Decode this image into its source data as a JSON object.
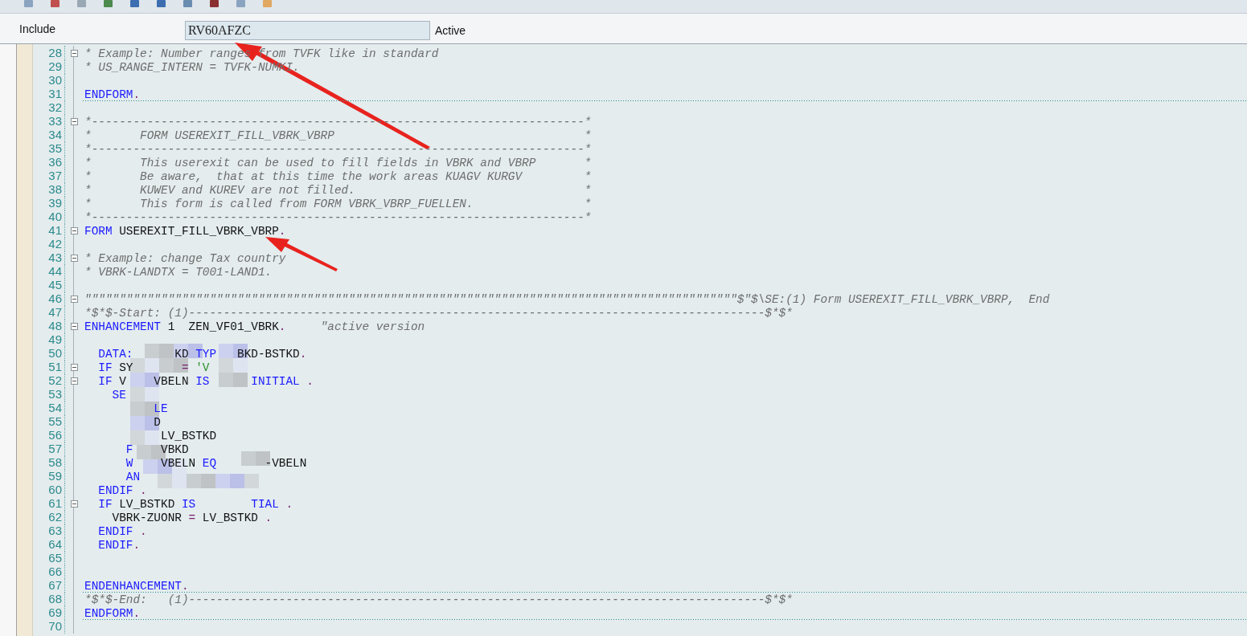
{
  "header": {
    "label": "Include",
    "value": "RV60AFZC",
    "status": "Active"
  },
  "editor": {
    "lines": [
      {
        "number": "28",
        "fold_start": true,
        "separator": false,
        "tokens": [
          {
            "kind": "comment",
            "text": "* Example: Number ranges from TVFK like in standard"
          }
        ]
      },
      {
        "number": "29",
        "fold_start": false,
        "separator": false,
        "tokens": [
          {
            "kind": "comment",
            "text": "* US_RANGE_INTERN = TVFK-NUMKI."
          }
        ]
      },
      {
        "number": "30",
        "fold_start": false,
        "separator": false
      },
      {
        "number": "31",
        "fold_start": false,
        "separator": true,
        "tokens": [
          {
            "kind": "keyword",
            "text": "ENDFORM"
          },
          {
            "kind": "punct",
            "text": "."
          }
        ]
      },
      {
        "number": "32",
        "fold_start": false,
        "separator": false
      },
      {
        "number": "33",
        "fold_start": true,
        "separator": false,
        "tokens": [
          {
            "kind": "comment",
            "text": "*-----------------------------------------------------------------------*"
          }
        ]
      },
      {
        "number": "34",
        "fold_start": false,
        "separator": false,
        "tokens": [
          {
            "kind": "comment",
            "text": "*       FORM USEREXIT_FILL_VBRK_VBRP                                    *"
          }
        ]
      },
      {
        "number": "35",
        "fold_start": false,
        "separator": false,
        "tokens": [
          {
            "kind": "comment",
            "text": "*-----------------------------------------------------------------------*"
          }
        ]
      },
      {
        "number": "36",
        "fold_start": false,
        "separator": false,
        "tokens": [
          {
            "kind": "comment",
            "text": "*       This userexit can be used to fill fields in VBRK and VBRP       *"
          }
        ]
      },
      {
        "number": "37",
        "fold_start": false,
        "separator": false,
        "tokens": [
          {
            "kind": "comment",
            "text": "*       Be aware,  that at this time the work areas KUAGV KURGV         *"
          }
        ]
      },
      {
        "number": "38",
        "fold_start": false,
        "separator": false,
        "tokens": [
          {
            "kind": "comment",
            "text": "*       KUWEV and KUREV are not filled.                                 *"
          }
        ]
      },
      {
        "number": "39",
        "fold_start": false,
        "separator": false,
        "tokens": [
          {
            "kind": "comment",
            "text": "*       This form is called from FORM VBRK_VBRP_FUELLEN.                *"
          }
        ]
      },
      {
        "number": "40",
        "fold_start": false,
        "separator": false,
        "tokens": [
          {
            "kind": "comment",
            "text": "*-----------------------------------------------------------------------*"
          }
        ]
      },
      {
        "number": "41",
        "fold_start": true,
        "separator": false,
        "tokens": [
          {
            "kind": "keyword",
            "text": "FORM"
          },
          {
            "kind": "plain",
            "text": " USEREXIT_FILL_VBRK_VBRP"
          },
          {
            "kind": "punct",
            "text": "."
          }
        ]
      },
      {
        "number": "42",
        "fold_start": false,
        "separator": false
      },
      {
        "number": "43",
        "fold_start": true,
        "separator": false,
        "tokens": [
          {
            "kind": "comment",
            "text": "* Example: change Tax country"
          }
        ]
      },
      {
        "number": "44",
        "fold_start": false,
        "separator": false,
        "tokens": [
          {
            "kind": "comment",
            "text": "* VBRK-LANDTX = T001-LAND1."
          }
        ]
      },
      {
        "number": "45",
        "fold_start": false,
        "separator": false
      },
      {
        "number": "46",
        "fold_start": true,
        "separator": false,
        "tokens": [
          {
            "kind": "comment",
            "text": "\"\"\"\"\"\"\"\"\"\"\"\"\"\"\"\"\"\"\"\"\"\"\"\"\"\"\"\"\"\"\"\"\"\"\"\"\"\"\"\"\"\"\"\"\"\"\"\"\"\"\"\"\"\"\"\"\"\"\"\"\"\"\"\"\"\"\"\"\"\"\"\"\"\"\"\"\"\"\"\"\"\"\"\"\"\"\"\"\"\"\"\"\"\"$\"$\\SE:(1) Form USEREXIT_FILL_VBRK_VBRP,  End"
          }
        ]
      },
      {
        "number": "47",
        "fold_start": false,
        "separator": false,
        "tokens": [
          {
            "kind": "comment",
            "text": "*$*$-Start: (1)-----------------------------------------------------------------------------------$*$*"
          }
        ]
      },
      {
        "number": "48",
        "fold_start": true,
        "separator": false,
        "tokens": [
          {
            "kind": "keyword",
            "text": "ENHANCEMENT"
          },
          {
            "kind": "plain",
            "text": " 1  ZEN_VF01_VBRK"
          },
          {
            "kind": "punct",
            "text": "."
          },
          {
            "kind": "comment",
            "text": "     \"active version"
          }
        ]
      },
      {
        "number": "49",
        "fold_start": false,
        "separator": false
      },
      {
        "number": "50",
        "fold_start": false,
        "separator": false,
        "tokens": [
          {
            "kind": "keyword",
            "text": "  DATA:"
          },
          {
            "kind": "plain",
            "text": "      KD "
          },
          {
            "kind": "keyword",
            "text": "TYP"
          },
          {
            "kind": "plain",
            "text": "   BKD-BSTKD"
          },
          {
            "kind": "punct",
            "text": "."
          }
        ]
      },
      {
        "number": "51",
        "fold_start": true,
        "separator": false,
        "tokens": [
          {
            "kind": "keyword",
            "text": "  IF"
          },
          {
            "kind": "plain",
            "text": " SY       "
          },
          {
            "kind": "punct",
            "text": "="
          },
          {
            "kind": "string",
            "text": " 'V"
          }
        ]
      },
      {
        "number": "52",
        "fold_start": true,
        "separator": false,
        "tokens": [
          {
            "kind": "keyword",
            "text": "  IF"
          },
          {
            "kind": "plain",
            "text": " V    VBELN "
          },
          {
            "kind": "keyword",
            "text": "IS"
          },
          {
            "kind": "keyword",
            "text": "      INITIAL"
          },
          {
            "kind": "punct",
            "text": " ."
          }
        ]
      },
      {
        "number": "53",
        "fold_start": false,
        "separator": false,
        "tokens": [
          {
            "kind": "keyword",
            "text": "    SE"
          }
        ]
      },
      {
        "number": "54",
        "fold_start": false,
        "separator": false,
        "tokens": [
          {
            "kind": "keyword",
            "text": "          LE"
          }
        ]
      },
      {
        "number": "55",
        "fold_start": false,
        "separator": false,
        "tokens": [
          {
            "kind": "plain",
            "text": "          D"
          }
        ]
      },
      {
        "number": "56",
        "fold_start": false,
        "separator": false,
        "tokens": [
          {
            "kind": "plain",
            "text": "           LV_BSTKD"
          }
        ]
      },
      {
        "number": "57",
        "fold_start": false,
        "separator": false,
        "tokens": [
          {
            "kind": "keyword",
            "text": "      F"
          },
          {
            "kind": "plain",
            "text": "    VBKD"
          }
        ]
      },
      {
        "number": "58",
        "fold_start": false,
        "separator": false,
        "tokens": [
          {
            "kind": "keyword",
            "text": "      W"
          },
          {
            "kind": "plain",
            "text": "    VBELN "
          },
          {
            "kind": "keyword",
            "text": "EQ"
          },
          {
            "kind": "plain",
            "text": "       -VBELN"
          }
        ]
      },
      {
        "number": "59",
        "fold_start": false,
        "separator": false,
        "tokens": [
          {
            "kind": "keyword",
            "text": "      AN"
          }
        ]
      },
      {
        "number": "60",
        "fold_start": false,
        "separator": false,
        "tokens": [
          {
            "kind": "keyword",
            "text": "  ENDIF"
          },
          {
            "kind": "punct",
            "text": " ."
          }
        ]
      },
      {
        "number": "61",
        "fold_start": true,
        "separator": false,
        "tokens": [
          {
            "kind": "keyword",
            "text": "  IF"
          },
          {
            "kind": "plain",
            "text": " LV_BSTKD "
          },
          {
            "kind": "keyword",
            "text": "IS"
          },
          {
            "kind": "keyword",
            "text": "        TIAL"
          },
          {
            "kind": "punct",
            "text": " ."
          }
        ]
      },
      {
        "number": "62",
        "fold_start": false,
        "separator": false,
        "tokens": [
          {
            "kind": "plain",
            "text": "    VBRK-ZUONR "
          },
          {
            "kind": "punct",
            "text": "="
          },
          {
            "kind": "plain",
            "text": " LV_BSTKD "
          },
          {
            "kind": "punct",
            "text": "."
          }
        ]
      },
      {
        "number": "63",
        "fold_start": false,
        "separator": false,
        "tokens": [
          {
            "kind": "keyword",
            "text": "  ENDIF"
          },
          {
            "kind": "punct",
            "text": " ."
          }
        ]
      },
      {
        "number": "64",
        "fold_start": false,
        "separator": false,
        "tokens": [
          {
            "kind": "keyword",
            "text": "  ENDIF"
          },
          {
            "kind": "punct",
            "text": "."
          }
        ]
      },
      {
        "number": "65",
        "fold_start": false,
        "separator": false
      },
      {
        "number": "66",
        "fold_start": false,
        "separator": false
      },
      {
        "number": "67",
        "fold_start": false,
        "separator": true,
        "tokens": [
          {
            "kind": "keyword",
            "text": "ENDENHANCEMENT"
          },
          {
            "kind": "punct",
            "text": "."
          }
        ]
      },
      {
        "number": "68",
        "fold_start": false,
        "separator": false,
        "tokens": [
          {
            "kind": "comment",
            "text": "*$*$-End:   (1)-----------------------------------------------------------------------------------$*$*"
          }
        ]
      },
      {
        "number": "69",
        "fold_start": false,
        "separator": true,
        "tokens": [
          {
            "kind": "keyword",
            "text": "ENDFORM"
          },
          {
            "kind": "punct",
            "text": "."
          }
        ]
      },
      {
        "number": "70",
        "fold_start": false,
        "separator": false
      }
    ]
  }
}
